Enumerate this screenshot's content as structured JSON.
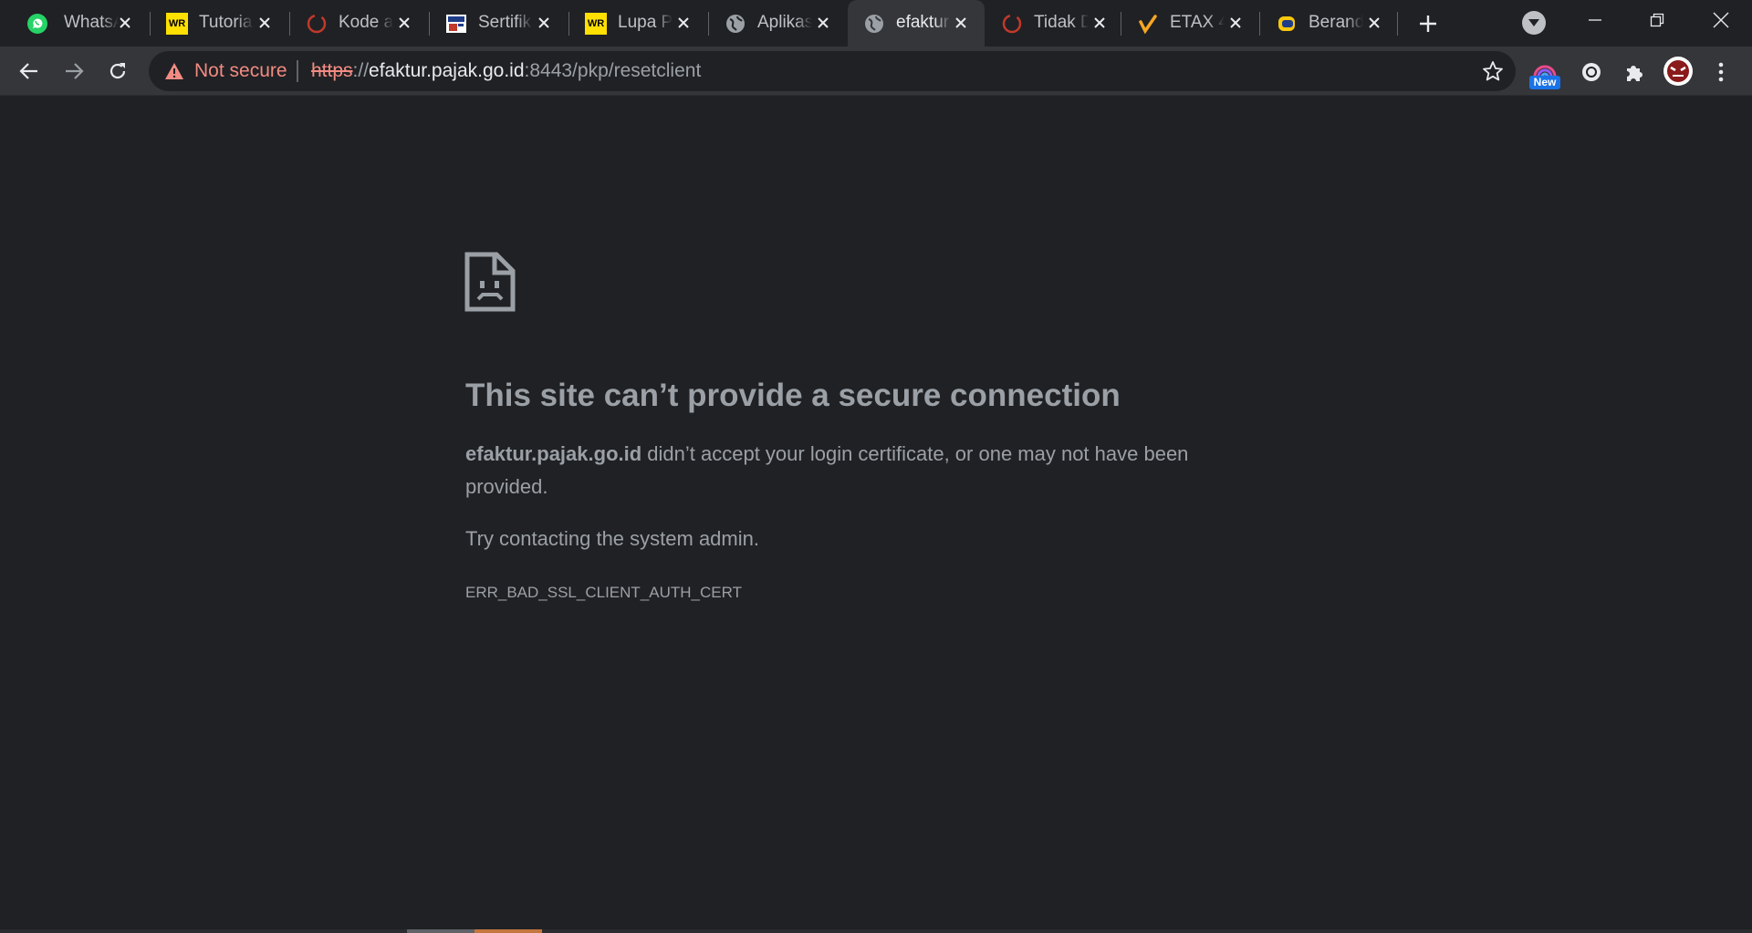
{
  "browser": {
    "tabs": [
      {
        "title": "WhatsApp",
        "favicon": "whatsapp-icon",
        "active": false
      },
      {
        "title": "Tutorial",
        "favicon": "wr-icon",
        "active": false
      },
      {
        "title": "Kode a",
        "favicon": "loading-ring-icon",
        "active": false
      },
      {
        "title": "Sertifik",
        "favicon": "certificate-icon",
        "active": false
      },
      {
        "title": "Lupa P",
        "favicon": "wr-icon",
        "active": false
      },
      {
        "title": "Aplikas",
        "favicon": "globe-icon",
        "active": false
      },
      {
        "title": "efaktur",
        "favicon": "globe-icon",
        "active": true
      },
      {
        "title": "Tidak D",
        "favicon": "loading-ring-icon",
        "active": false
      },
      {
        "title": "ETAX 4",
        "favicon": "checkmark-icon",
        "active": false
      },
      {
        "title": "Berand",
        "favicon": "beranda-icon",
        "active": false
      }
    ],
    "wr_badge_text": "WR",
    "new_tab_icon": "plus-icon",
    "tab_search_icon": "chevron-down-icon",
    "window_controls": [
      "minimize-icon",
      "restore-icon",
      "close-icon"
    ]
  },
  "toolbar": {
    "security_label": "Not secure",
    "url_scheme": "https",
    "url_separator": "://",
    "url_host": "efaktur.pajak.go.id",
    "url_rest": ":8443/pkp/resetclient",
    "extension_badge": "New"
  },
  "error": {
    "title": "This site can’t provide a secure connection",
    "host": "efaktur.pajak.go.id",
    "description": " didn’t accept your login certificate, or one may not have been provided.",
    "suggestion": "Try contacting the system admin.",
    "code": "ERR_BAD_SSL_CLIENT_AUTH_CERT"
  },
  "colors": {
    "background": "#202124",
    "toolbar": "#35363a",
    "warning": "#f28b82",
    "text_muted": "#9aa0a6"
  }
}
